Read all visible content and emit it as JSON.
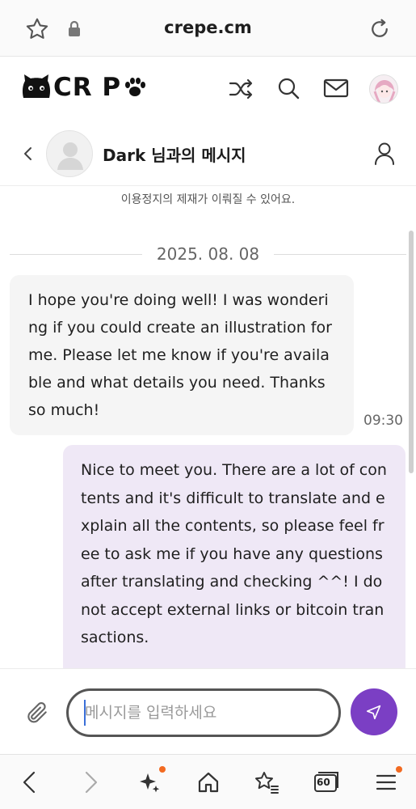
{
  "browser": {
    "url": "crepe.cm",
    "tab_count": "60"
  },
  "site": {
    "logo_text": "CR P"
  },
  "conversation": {
    "title": "Dark 님과의 메시지"
  },
  "messages": {
    "notice": "이용정지의 제재가 이뤄질 수 있어요.",
    "date": "2025. 08. 08",
    "incoming": {
      "text": "I hope you're doing well! I was wondering if you could create an illustration for me. Please let me know if you're available and what details you need. Thanks so much!",
      "time": "09:30"
    },
    "outgoing": {
      "text": "Nice to meet you. There are a lot of contents and it's difficult to translate and explain all the contents, so please feel free to ask me if you have any questions after translating and checking ^^! I do not accept external links or bitcoin transactions."
    }
  },
  "composer": {
    "placeholder": "메시지를 입력하세요"
  },
  "colors": {
    "accent": "#7b3fc4",
    "outgoing_bubble": "#efe8f6",
    "incoming_bubble": "#f5f5f5",
    "badge_dot": "#f26a21"
  },
  "icons": {
    "urlbar": [
      "star-outline-icon",
      "lock-icon",
      "reload-icon"
    ],
    "header": [
      "shuffle-icon",
      "search-icon",
      "mail-icon",
      "profile-avatar"
    ],
    "conversation": [
      "chevron-left-icon",
      "user-avatar-placeholder",
      "person-icon"
    ],
    "composer": [
      "paperclip-icon",
      "send-icon"
    ],
    "bottom_nav": [
      "back-icon",
      "forward-icon",
      "sparkle-icon",
      "home-icon",
      "bookmarks-icon",
      "tabs-icon",
      "menu-icon"
    ]
  }
}
